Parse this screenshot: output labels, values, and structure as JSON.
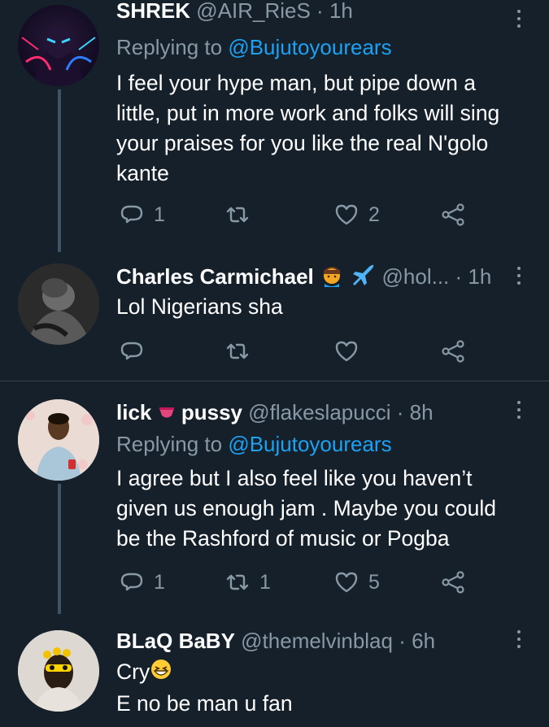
{
  "tweets": [
    {
      "name": "SHREK",
      "handle": "@AIR_RieS",
      "dot": "·",
      "time": "1h",
      "reply_prefix": "Replying to",
      "reply_handle": "@Bujutoyourears",
      "text_lines": [
        "I feel your hype man, but pipe down a",
        "little, put in more work and folks will sing",
        "your praises for you like the real N'golo",
        "kante"
      ],
      "replies": "1",
      "retweets": "",
      "likes": "2"
    },
    {
      "name": "Charles Carmichael",
      "handle": "@hol...",
      "dot": "·",
      "time": "1h",
      "text_lines": [
        "Lol Nigerians sha"
      ],
      "replies": "",
      "retweets": "",
      "likes": ""
    },
    {
      "name_part1": "lick",
      "name_part2": "pussy",
      "handle": "@flakeslapucci",
      "dot": "·",
      "time": "8h",
      "reply_prefix": "Replying to",
      "reply_handle": "@Bujutoyourears",
      "text_lines": [
        "I agree but I also feel like you haven’t",
        "given us enough jam . Maybe you could",
        "be the Rashford of music or Pogba"
      ],
      "replies": "1",
      "retweets": "1",
      "likes": "5"
    },
    {
      "name": "BLaQ BaBY",
      "handle": "@themelvinblaq",
      "dot": "·",
      "time": "6h",
      "text_line1": "Cry",
      "text_line2": "E no be man u fan"
    }
  ],
  "colors": {
    "background": "#15202b",
    "secondary_text": "#8899a6",
    "link": "#1da1f2",
    "divider": "#38444d"
  },
  "icons": {
    "reply": "reply-icon",
    "retweet": "retweet-icon",
    "like": "heart-icon",
    "share": "share-icon",
    "menu": "more-vertical-icon"
  }
}
